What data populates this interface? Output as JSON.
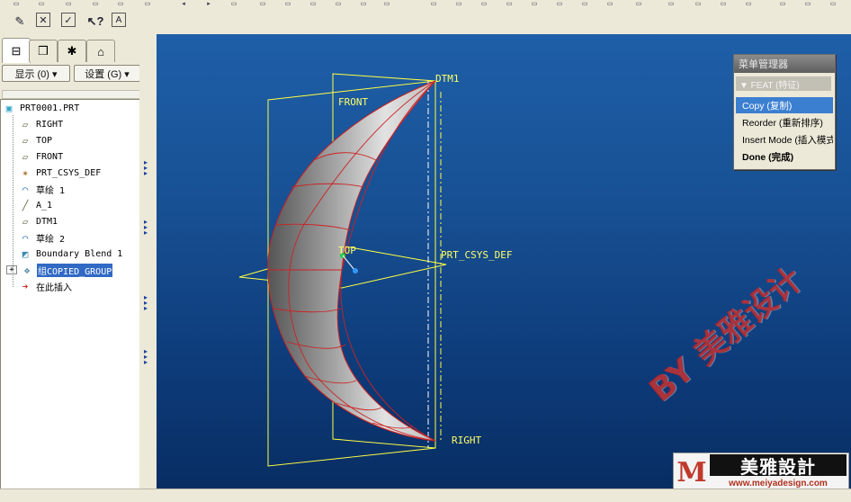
{
  "toolbar": {
    "row2_icons": [
      "edit-definition-icon",
      "delete-icon",
      "regenerate-icon",
      "whats-this-icon",
      "annotation-icon"
    ]
  },
  "left_panel": {
    "tabs": [
      "model-tree-tab",
      "layers-tab",
      "favorites-tab",
      "connections-tab"
    ],
    "show_dropdown": "显示 (0) ▾",
    "settings_dropdown": "设置 (G) ▾"
  },
  "model_tree": {
    "items": [
      {
        "label": "PRT0001.PRT",
        "icon": "part-icon",
        "selected": false
      },
      {
        "label": "RIGHT",
        "icon": "datum-plane-icon",
        "selected": false
      },
      {
        "label": "TOP",
        "icon": "datum-plane-icon",
        "selected": false
      },
      {
        "label": "FRONT",
        "icon": "datum-plane-icon",
        "selected": false
      },
      {
        "label": "PRT_CSYS_DEF",
        "icon": "csys-icon",
        "selected": false
      },
      {
        "label": "草绘 1",
        "icon": "sketch-icon",
        "selected": false
      },
      {
        "label": "A_1",
        "icon": "axis-icon",
        "selected": false
      },
      {
        "label": "DTM1",
        "icon": "datum-plane-icon",
        "selected": false
      },
      {
        "label": "草绘 2",
        "icon": "sketch-icon",
        "selected": false
      },
      {
        "label": "Boundary Blend 1",
        "icon": "blend-icon",
        "selected": false
      },
      {
        "label": "组COPIED_GROUP",
        "icon": "group-icon",
        "selected": true
      },
      {
        "label": "在此插入",
        "icon": "insert-arrow-icon",
        "selected": false
      }
    ]
  },
  "viewport": {
    "labels": {
      "dtm1": "DTM1",
      "front": "FRONT",
      "top": "TOP",
      "csys": "PRT_CSYS_DEF",
      "right": "RIGHT"
    },
    "colors": {
      "background_top": "#1e5fa8",
      "background_bottom": "#082e63",
      "datum": "#ffff33",
      "edge": "#cc2222"
    }
  },
  "menu_manager": {
    "title": "菜单管理器",
    "header": "▼ FEAT (特征)",
    "items": [
      {
        "label": "Copy (复制)",
        "highlighted": true,
        "bold": false
      },
      {
        "label": "Reorder (重新排序)",
        "highlighted": false,
        "bold": false
      },
      {
        "label": "Insert Mode (插入模式)",
        "highlighted": false,
        "bold": false
      },
      {
        "label": "Done (完成)",
        "highlighted": false,
        "bold": true
      }
    ]
  },
  "watermark": {
    "text": "BY 美雅设计",
    "logo_mark": "M",
    "logo_name": "美雅設計",
    "logo_url": "www.meiyadesign.com"
  }
}
